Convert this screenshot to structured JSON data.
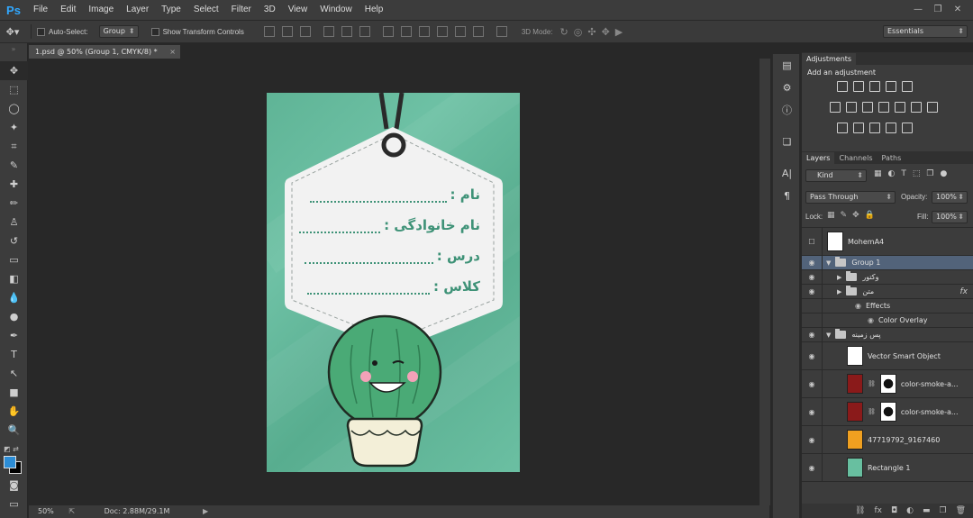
{
  "app": {
    "logo": "Ps",
    "accent": "#31a8ff"
  },
  "menu": [
    "File",
    "Edit",
    "Image",
    "Layer",
    "Type",
    "Select",
    "Filter",
    "3D",
    "View",
    "Window",
    "Help"
  ],
  "window_controls": [
    "—",
    "❐",
    "✕"
  ],
  "options": {
    "auto_select_label": "Auto-Select:",
    "auto_select_value": "Group",
    "transform_label": "Show Transform Controls",
    "mode3d_label": "3D Mode:",
    "workspace": "Essentials"
  },
  "document": {
    "tab_title": "1.psd @ 50% (Group 1, CMYK/8) *",
    "zoom": "50%",
    "doc_size": "Doc: 2.88M/29.1M"
  },
  "artwork": {
    "labels": [
      "نام :",
      "نام خانوادگی :",
      "درس :",
      "کلاس :"
    ],
    "bg_color": "#63b89a",
    "text_color": "#3e9277"
  },
  "tools": [
    "move-icon",
    "marquee-icon",
    "lasso-icon",
    "magic-wand-icon",
    "crop-icon",
    "eyedropper-icon",
    "healing-icon",
    "brush-icon",
    "stamp-icon",
    "history-brush-icon",
    "eraser-icon",
    "gradient-icon",
    "blur-icon",
    "dodge-icon",
    "pen-icon",
    "type-icon",
    "path-select-icon",
    "rectangle-icon",
    "hand-icon",
    "zoom-icon"
  ],
  "tool_glyphs": [
    "✥",
    "⬚",
    "◯",
    "✦",
    "⌗",
    "✎",
    "✚",
    "✏",
    "♙",
    "↺",
    "▭",
    "◧",
    "💧",
    "●",
    "✒",
    "T",
    "↖",
    "■",
    "✋",
    "🔍"
  ],
  "colors": {
    "foreground": "#2c8dd6",
    "background": "#000000"
  },
  "adjustments": {
    "tab": "Adjustments",
    "subtitle": "Add an adjustment"
  },
  "layers_panel": {
    "tabs": [
      "Layers",
      "Channels",
      "Paths"
    ],
    "kind_label": "Kind",
    "blend_mode": "Pass Through",
    "opacity_label": "Opacity:",
    "opacity": "100%",
    "lock_label": "Lock:",
    "fill_label": "Fill:",
    "fill": "100%",
    "layers": [
      {
        "name": "MohemA4",
        "visible": false,
        "kind": "thumb"
      },
      {
        "name": "Group 1",
        "visible": true,
        "kind": "group",
        "selected": true
      },
      {
        "name": "وکتور",
        "visible": true,
        "kind": "group-collapsed"
      },
      {
        "name": "متن",
        "visible": true,
        "kind": "group-collapsed",
        "fx": "fx"
      },
      {
        "name": "Effects",
        "kind": "effect"
      },
      {
        "name": "Color Overlay",
        "kind": "effect-item"
      },
      {
        "name": "پس زمینه",
        "visible": true,
        "kind": "group"
      },
      {
        "name": "Vector Smart Object",
        "visible": true,
        "kind": "smart",
        "thumb_color": "#ffffff"
      },
      {
        "name": "color-smoke-a...",
        "visible": true,
        "kind": "masked",
        "thumb_color": "#8a1a1a"
      },
      {
        "name": "color-smoke-a...",
        "visible": true,
        "kind": "masked",
        "thumb_color": "#8a1a1a"
      },
      {
        "name": "47719792_9167460",
        "visible": true,
        "kind": "smart",
        "thumb_color": "#f0a020"
      },
      {
        "name": "Rectangle 1",
        "visible": true,
        "kind": "smart",
        "thumb_color": "#68bfa0"
      }
    ]
  }
}
